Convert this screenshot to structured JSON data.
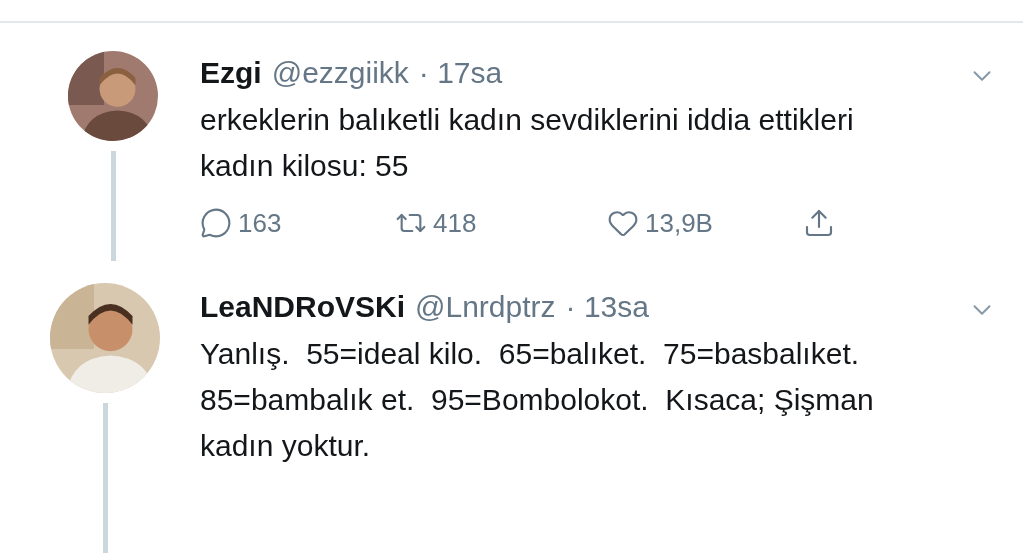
{
  "tweets": [
    {
      "name": "Ezgi",
      "handle": "@ezzgiikk",
      "time": "· 17sa",
      "text": "erkeklerin balıketli kadın sevdiklerini iddia ettikleri kadın kilosu: 55",
      "actions": [
        {
          "kind": "reply",
          "count": "163"
        },
        {
          "kind": "retweet",
          "count": "418"
        },
        {
          "kind": "like",
          "count": "13,9B"
        },
        {
          "kind": "share"
        }
      ]
    },
    {
      "name": "LeaNDRoVSKi",
      "handle": "@Lnrdptrz",
      "time": "· 13sa",
      "text": "Yanlış.  55=ideal kilo.  65=balıket.  75=basbalıket.  85=bambalık et.  95=Bombolokot.  Kısaca; Şişman kadın yoktur."
    }
  ]
}
